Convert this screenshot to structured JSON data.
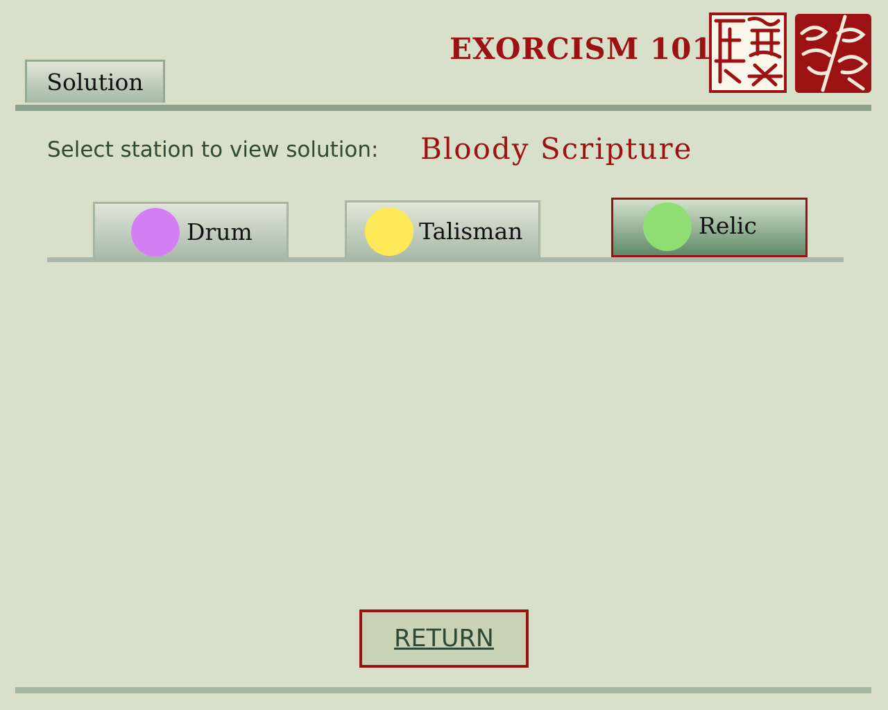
{
  "header": {
    "app_title": "EXORCISM 101",
    "tab_label": "Solution"
  },
  "prompt": {
    "label": "Select station to view solution:",
    "scenario": "Bloody Scripture"
  },
  "stations": [
    {
      "label": "Drum",
      "color": "#d57df5",
      "selected": false
    },
    {
      "label": "Talisman",
      "color": "#fde957",
      "selected": false
    },
    {
      "label": "Relic",
      "color": "#8ede74",
      "selected": true
    }
  ],
  "footer": {
    "return_label": "RETURN"
  },
  "colors": {
    "background": "#d9e0ca",
    "accent_red": "#9b1114",
    "text_green": "#2f4a34"
  }
}
